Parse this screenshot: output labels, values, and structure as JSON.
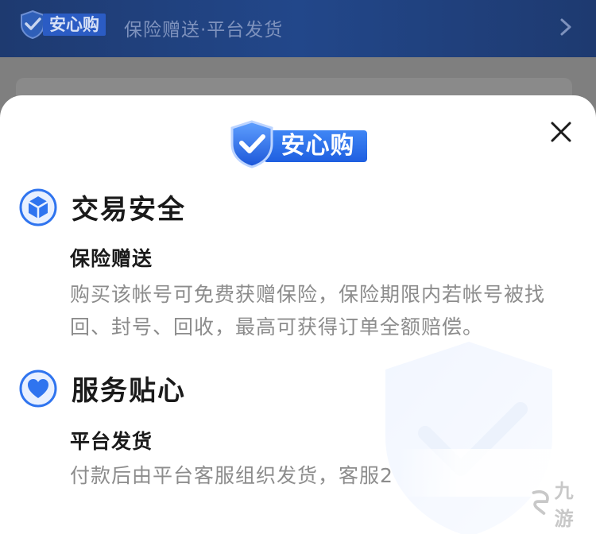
{
  "top_banner": {
    "badge_label": "安心购",
    "summary": "保险赠送·平台发货",
    "arrow_icon": "chevron-right-icon"
  },
  "sheet": {
    "logo_label": "安心购",
    "close_icon": "close-icon",
    "sections": [
      {
        "icon": "cube-shield-icon",
        "title": "交易安全",
        "subtitle": "保险赠送",
        "description": "购买该帐号可免费获赠保险，保险期限内若帐号被找回、封号、回收，最高可获得订单全额赔偿。"
      },
      {
        "icon": "heart-icon",
        "title": "服务贴心",
        "subtitle": "平台发货",
        "description": "付款后由平台客服组织发货，客服2"
      }
    ]
  },
  "watermark": {
    "brand": "九游"
  },
  "colors": {
    "brand_blue": "#2f74ef",
    "title_text": "#1a1a1a",
    "desc_text": "#8c8c8c"
  }
}
